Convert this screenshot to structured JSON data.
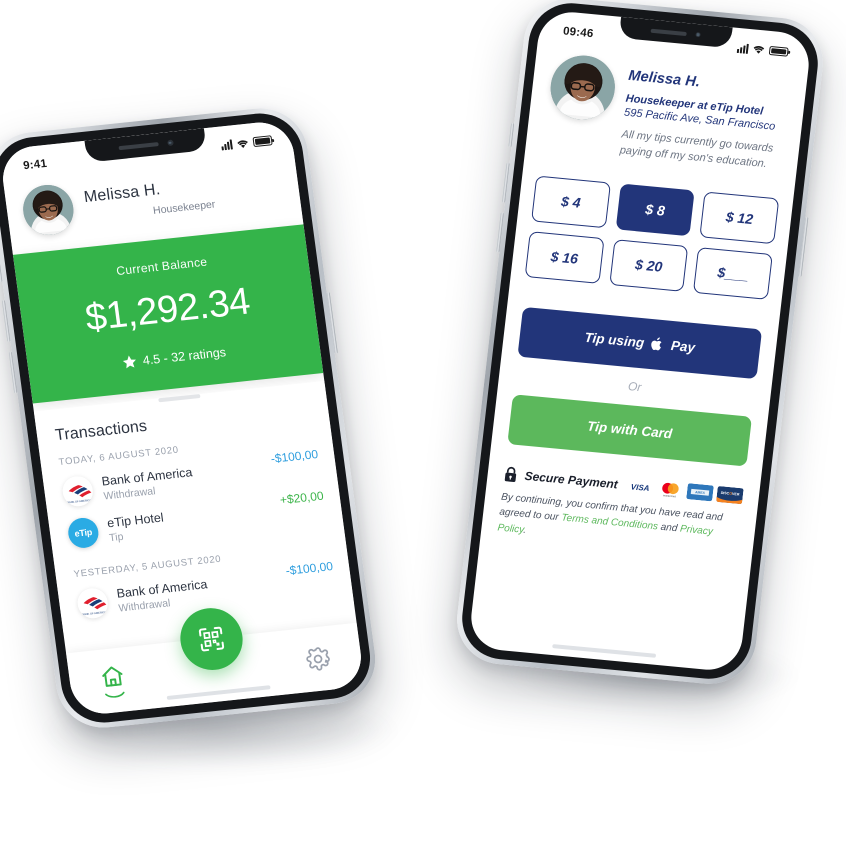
{
  "left_phone": {
    "status_bar": {
      "time": "9:41",
      "signal_icon": "cellular-bars-icon",
      "wifi_icon": "wifi-icon",
      "battery_icon": "battery-full-icon"
    },
    "profile": {
      "avatar_icon": "user-avatar",
      "name": "Melissa H.",
      "role": "Housekeeper"
    },
    "balance": {
      "label": "Current Balance",
      "amount": "$1,292.34",
      "star_icon": "star-icon",
      "rating_text": "4.5 - 32 ratings",
      "background_color": "#34b44a"
    },
    "transactions": {
      "section_title": "Transactions",
      "groups": [
        {
          "day_label": "TODAY, 6 AUGUST 2020",
          "items": [
            {
              "logo_icon": "bank-of-america-logo",
              "title": "Bank of America",
              "subtitle": "Withdrawal",
              "amount": "-$100,00",
              "amount_kind": "negative"
            },
            {
              "logo_icon": "etip-logo",
              "logo_text": "eTip",
              "title": "eTip Hotel",
              "subtitle": "Tip",
              "amount": "+$20,00",
              "amount_kind": "positive"
            }
          ]
        },
        {
          "day_label": "YESTERDAY, 5 AUGUST 2020",
          "items": [
            {
              "logo_icon": "bank-of-america-logo",
              "title": "Bank of America",
              "subtitle": "Withdrawal",
              "amount": "-$100,00",
              "amount_kind": "negative"
            }
          ]
        }
      ]
    },
    "tab_bar": {
      "home_icon": "home-icon",
      "scan_icon": "qr-scan-icon",
      "settings_icon": "gear-icon",
      "active_tab": "home",
      "fab_color": "#34b44a"
    }
  },
  "right_phone": {
    "status_bar": {
      "time": "09:46",
      "signal_icon": "cellular-bars-icon",
      "wifi_icon": "wifi-icon",
      "battery_icon": "battery-full-icon"
    },
    "profile": {
      "avatar_icon": "user-avatar",
      "name": "Melissa H.",
      "job_title": "Housekeeper at eTip Hotel",
      "address": "595 Pacific Ave, San Francisco",
      "bio": "All my tips currently go towards paying off my son's education."
    },
    "tip_amounts": {
      "options": [
        {
          "label": "$ 4",
          "selected": false
        },
        {
          "label": "$ 8",
          "selected": true
        },
        {
          "label": "$ 12",
          "selected": false
        },
        {
          "label": "$ 16",
          "selected": false
        },
        {
          "label": "$ 20",
          "selected": false
        },
        {
          "label": "$___",
          "selected": false
        }
      ],
      "selected_color": "#22357a"
    },
    "payment": {
      "apple_pay_prefix": "Tip using",
      "apple_logo_icon": "apple-logo-icon",
      "apple_pay_suffix": "Pay",
      "apple_pay_color": "#22357a",
      "or_label": "Or",
      "card_button_label": "Tip with Card",
      "card_button_color": "#5cb85c"
    },
    "secure": {
      "lock_icon": "lock-icon",
      "label": "Secure Payment",
      "card_logos": [
        {
          "icon": "visa-logo",
          "label": "VISA"
        },
        {
          "icon": "mastercard-logo",
          "label": "mastercard"
        },
        {
          "icon": "amex-logo",
          "label": "AMEX"
        },
        {
          "icon": "discover-logo",
          "label": "DISCOVER"
        }
      ]
    },
    "legal": {
      "text_before": "By continuing, you confirm that you have read and agreed to our ",
      "terms_link": "Terms and Conditions",
      "text_between": " and ",
      "privacy_link": "Privacy Policy",
      "text_after": ".",
      "link_color": "#5cb85c"
    }
  }
}
